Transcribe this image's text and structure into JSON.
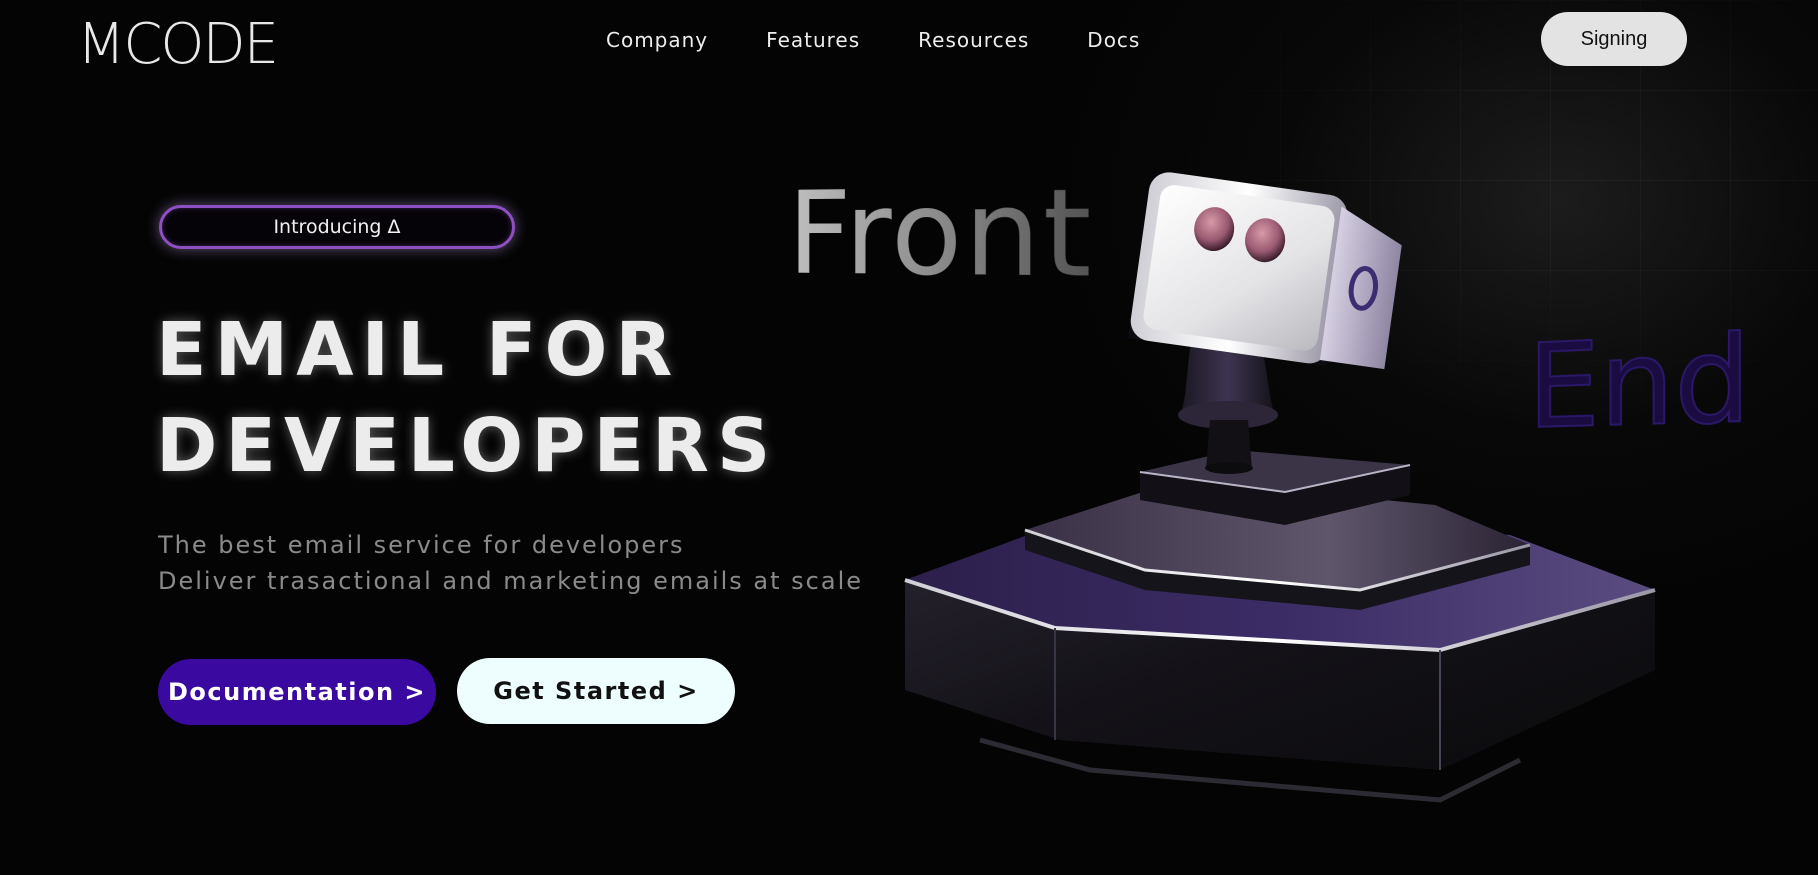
{
  "header": {
    "logo": "MCODE",
    "nav": [
      "Company",
      "Features",
      "Resources",
      "Docs"
    ],
    "signin_label": "Signing"
  },
  "hero": {
    "badge": "Introducing Δ",
    "title_line1": "EMAIL FOR",
    "title_line2": "DEVELOPERS",
    "subtitle_line1": "The best email service for developers",
    "subtitle_line2": "Deliver trasactional and marketing emails at scale",
    "docs_button": "Documentation >",
    "start_button": "Get Started >"
  },
  "floating_words": {
    "front": "Front",
    "end": "End"
  },
  "colors": {
    "background": "#040404",
    "accent_purple": "#3a0aa0",
    "pill_border": "#8d4fc2",
    "start_button_bg": "#eefdfd"
  }
}
